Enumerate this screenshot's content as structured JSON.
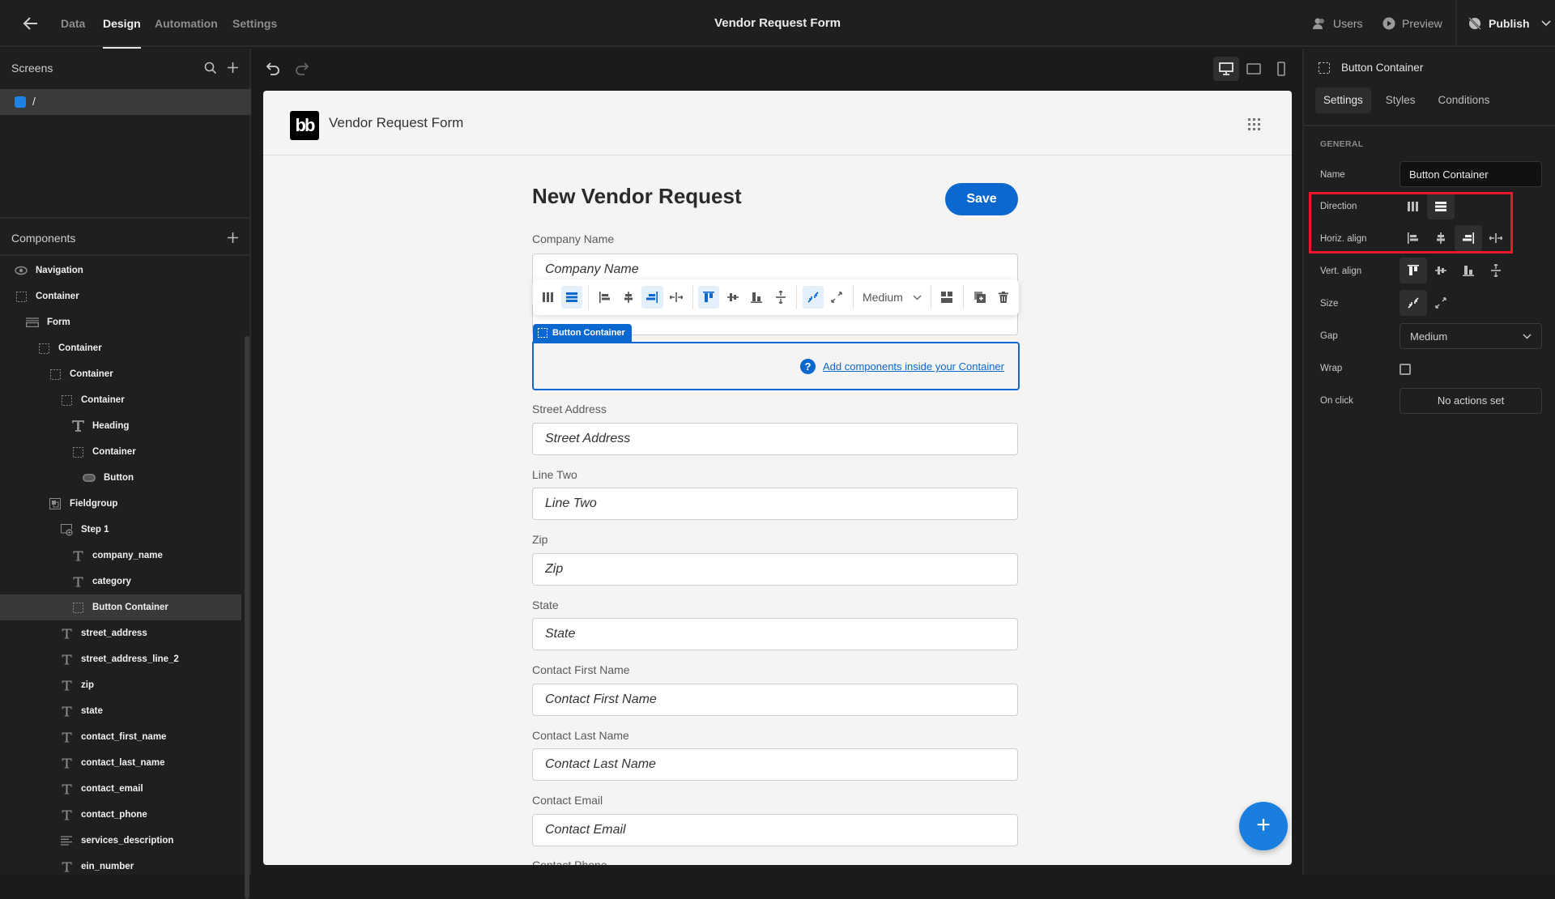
{
  "topbar": {
    "nav": [
      {
        "label": "Data",
        "active": false
      },
      {
        "label": "Design",
        "active": true
      },
      {
        "label": "Automation",
        "active": false
      },
      {
        "label": "Settings",
        "active": false
      }
    ],
    "title": "Vendor Request Form",
    "users_label": "Users",
    "preview_label": "Preview",
    "publish_label": "Publish"
  },
  "screens": {
    "title": "Screens",
    "items": [
      {
        "label": "/",
        "color": "#1c83e6",
        "selected": true
      }
    ]
  },
  "components": {
    "title": "Components",
    "tree": [
      {
        "label": "Navigation",
        "icon": "eye-icon",
        "depth": 0
      },
      {
        "label": "Container",
        "icon": "container-icon",
        "depth": 0
      },
      {
        "label": "Form",
        "icon": "form-icon",
        "depth": 1
      },
      {
        "label": "Container",
        "icon": "container-icon",
        "depth": 2
      },
      {
        "label": "Container",
        "icon": "container-icon",
        "depth": 3
      },
      {
        "label": "Container",
        "icon": "container-icon",
        "depth": 4
      },
      {
        "label": "Heading",
        "icon": "heading-icon",
        "depth": 5
      },
      {
        "label": "Container",
        "icon": "container-icon",
        "depth": 5
      },
      {
        "label": "Button",
        "icon": "button-icon",
        "depth": 6
      },
      {
        "label": "Fieldgroup",
        "icon": "fieldgroup-icon",
        "depth": 3
      },
      {
        "label": "Step 1",
        "icon": "step-icon",
        "depth": 4
      },
      {
        "label": "company_name",
        "icon": "text-field-icon",
        "depth": 5
      },
      {
        "label": "category",
        "icon": "text-field-icon",
        "depth": 5
      },
      {
        "label": "Button Container",
        "icon": "container-icon",
        "depth": 5,
        "selected": true
      },
      {
        "label": "street_address",
        "icon": "text-field-icon",
        "depth": 4
      },
      {
        "label": "street_address_line_2",
        "icon": "text-field-icon",
        "depth": 4
      },
      {
        "label": "zip",
        "icon": "text-field-icon",
        "depth": 4
      },
      {
        "label": "state",
        "icon": "text-field-icon",
        "depth": 4
      },
      {
        "label": "contact_first_name",
        "icon": "text-field-icon",
        "depth": 4
      },
      {
        "label": "contact_last_name",
        "icon": "text-field-icon",
        "depth": 4
      },
      {
        "label": "contact_email",
        "icon": "text-field-icon",
        "depth": 4
      },
      {
        "label": "contact_phone",
        "icon": "text-field-icon",
        "depth": 4
      },
      {
        "label": "services_description",
        "icon": "long-text-icon",
        "depth": 4
      },
      {
        "label": "ein_number",
        "icon": "text-field-icon",
        "depth": 4
      }
    ]
  },
  "canvas": {
    "app_name": "Vendor Request Form",
    "logo_text": "bb",
    "form_heading": "New Vendor Request",
    "save_label": "Save",
    "fields": [
      {
        "label": "Company Name",
        "placeholder": "Company Name"
      },
      {
        "label": "Street Address",
        "placeholder": "Street Address"
      },
      {
        "label": "Line Two",
        "placeholder": "Line Two"
      },
      {
        "label": "Zip",
        "placeholder": "Zip"
      },
      {
        "label": "State",
        "placeholder": "State"
      },
      {
        "label": "Contact First Name",
        "placeholder": "Contact First Name"
      },
      {
        "label": "Contact Last Name",
        "placeholder": "Contact Last Name"
      },
      {
        "label": "Contact Email",
        "placeholder": "Contact Email"
      },
      {
        "label": "Contact Phone",
        "placeholder": ""
      }
    ],
    "selected_tag": "Button Container",
    "empty_hint": "Add components inside your Container",
    "toolbar": {
      "gap_value": "Medium"
    },
    "fab_label": "+"
  },
  "settings_panel": {
    "component_name": "Button Container",
    "tabs": [
      {
        "label": "Settings",
        "active": true
      },
      {
        "label": "Styles",
        "active": false
      },
      {
        "label": "Conditions",
        "active": false
      }
    ],
    "section": "GENERAL",
    "name_label": "Name",
    "name_value": "Button Container",
    "direction_label": "Direction",
    "direction_value": "vertical",
    "horiz_align_label": "Horiz. align",
    "horiz_align_value": "right",
    "vert_align_label": "Vert. align",
    "vert_align_value": "top",
    "size_label": "Size",
    "size_value": "shrink",
    "gap_label": "Gap",
    "gap_value": "Medium",
    "wrap_label": "Wrap",
    "wrap_checked": false,
    "onclick_label": "On click",
    "onclick_value": "No actions set",
    "highlight_color": "#e8192c"
  },
  "colors": {
    "accent": "#0a68cf",
    "fab": "#1a7ee0"
  }
}
